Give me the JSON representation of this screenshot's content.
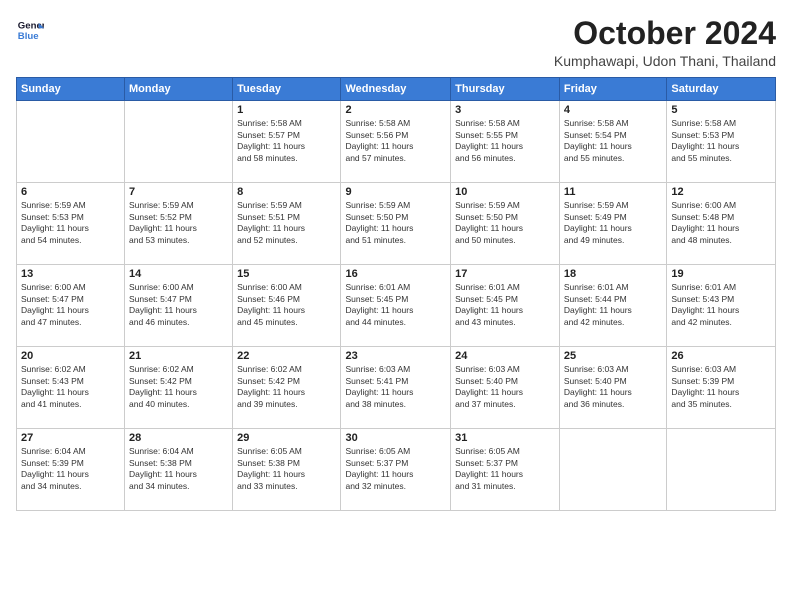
{
  "logo": {
    "line1": "General",
    "line2": "Blue"
  },
  "header": {
    "month": "October 2024",
    "location": "Kumphawapi, Udon Thani, Thailand"
  },
  "days_of_week": [
    "Sunday",
    "Monday",
    "Tuesday",
    "Wednesday",
    "Thursday",
    "Friday",
    "Saturday"
  ],
  "weeks": [
    [
      {
        "day": "",
        "detail": ""
      },
      {
        "day": "",
        "detail": ""
      },
      {
        "day": "1",
        "detail": "Sunrise: 5:58 AM\nSunset: 5:57 PM\nDaylight: 11 hours\nand 58 minutes."
      },
      {
        "day": "2",
        "detail": "Sunrise: 5:58 AM\nSunset: 5:56 PM\nDaylight: 11 hours\nand 57 minutes."
      },
      {
        "day": "3",
        "detail": "Sunrise: 5:58 AM\nSunset: 5:55 PM\nDaylight: 11 hours\nand 56 minutes."
      },
      {
        "day": "4",
        "detail": "Sunrise: 5:58 AM\nSunset: 5:54 PM\nDaylight: 11 hours\nand 55 minutes."
      },
      {
        "day": "5",
        "detail": "Sunrise: 5:58 AM\nSunset: 5:53 PM\nDaylight: 11 hours\nand 55 minutes."
      }
    ],
    [
      {
        "day": "6",
        "detail": "Sunrise: 5:59 AM\nSunset: 5:53 PM\nDaylight: 11 hours\nand 54 minutes."
      },
      {
        "day": "7",
        "detail": "Sunrise: 5:59 AM\nSunset: 5:52 PM\nDaylight: 11 hours\nand 53 minutes."
      },
      {
        "day": "8",
        "detail": "Sunrise: 5:59 AM\nSunset: 5:51 PM\nDaylight: 11 hours\nand 52 minutes."
      },
      {
        "day": "9",
        "detail": "Sunrise: 5:59 AM\nSunset: 5:50 PM\nDaylight: 11 hours\nand 51 minutes."
      },
      {
        "day": "10",
        "detail": "Sunrise: 5:59 AM\nSunset: 5:50 PM\nDaylight: 11 hours\nand 50 minutes."
      },
      {
        "day": "11",
        "detail": "Sunrise: 5:59 AM\nSunset: 5:49 PM\nDaylight: 11 hours\nand 49 minutes."
      },
      {
        "day": "12",
        "detail": "Sunrise: 6:00 AM\nSunset: 5:48 PM\nDaylight: 11 hours\nand 48 minutes."
      }
    ],
    [
      {
        "day": "13",
        "detail": "Sunrise: 6:00 AM\nSunset: 5:47 PM\nDaylight: 11 hours\nand 47 minutes."
      },
      {
        "day": "14",
        "detail": "Sunrise: 6:00 AM\nSunset: 5:47 PM\nDaylight: 11 hours\nand 46 minutes."
      },
      {
        "day": "15",
        "detail": "Sunrise: 6:00 AM\nSunset: 5:46 PM\nDaylight: 11 hours\nand 45 minutes."
      },
      {
        "day": "16",
        "detail": "Sunrise: 6:01 AM\nSunset: 5:45 PM\nDaylight: 11 hours\nand 44 minutes."
      },
      {
        "day": "17",
        "detail": "Sunrise: 6:01 AM\nSunset: 5:45 PM\nDaylight: 11 hours\nand 43 minutes."
      },
      {
        "day": "18",
        "detail": "Sunrise: 6:01 AM\nSunset: 5:44 PM\nDaylight: 11 hours\nand 42 minutes."
      },
      {
        "day": "19",
        "detail": "Sunrise: 6:01 AM\nSunset: 5:43 PM\nDaylight: 11 hours\nand 42 minutes."
      }
    ],
    [
      {
        "day": "20",
        "detail": "Sunrise: 6:02 AM\nSunset: 5:43 PM\nDaylight: 11 hours\nand 41 minutes."
      },
      {
        "day": "21",
        "detail": "Sunrise: 6:02 AM\nSunset: 5:42 PM\nDaylight: 11 hours\nand 40 minutes."
      },
      {
        "day": "22",
        "detail": "Sunrise: 6:02 AM\nSunset: 5:42 PM\nDaylight: 11 hours\nand 39 minutes."
      },
      {
        "day": "23",
        "detail": "Sunrise: 6:03 AM\nSunset: 5:41 PM\nDaylight: 11 hours\nand 38 minutes."
      },
      {
        "day": "24",
        "detail": "Sunrise: 6:03 AM\nSunset: 5:40 PM\nDaylight: 11 hours\nand 37 minutes."
      },
      {
        "day": "25",
        "detail": "Sunrise: 6:03 AM\nSunset: 5:40 PM\nDaylight: 11 hours\nand 36 minutes."
      },
      {
        "day": "26",
        "detail": "Sunrise: 6:03 AM\nSunset: 5:39 PM\nDaylight: 11 hours\nand 35 minutes."
      }
    ],
    [
      {
        "day": "27",
        "detail": "Sunrise: 6:04 AM\nSunset: 5:39 PM\nDaylight: 11 hours\nand 34 minutes."
      },
      {
        "day": "28",
        "detail": "Sunrise: 6:04 AM\nSunset: 5:38 PM\nDaylight: 11 hours\nand 34 minutes."
      },
      {
        "day": "29",
        "detail": "Sunrise: 6:05 AM\nSunset: 5:38 PM\nDaylight: 11 hours\nand 33 minutes."
      },
      {
        "day": "30",
        "detail": "Sunrise: 6:05 AM\nSunset: 5:37 PM\nDaylight: 11 hours\nand 32 minutes."
      },
      {
        "day": "31",
        "detail": "Sunrise: 6:05 AM\nSunset: 5:37 PM\nDaylight: 11 hours\nand 31 minutes."
      },
      {
        "day": "",
        "detail": ""
      },
      {
        "day": "",
        "detail": ""
      }
    ]
  ]
}
